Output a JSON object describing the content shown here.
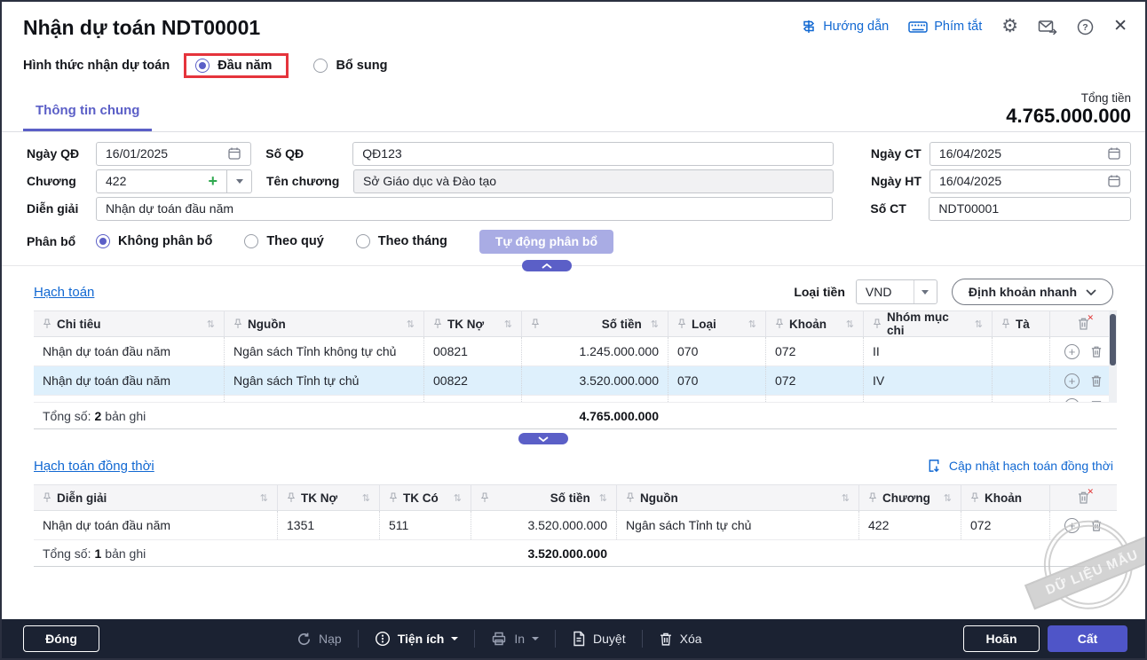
{
  "colors": {
    "accent": "#5b5fc7",
    "save_button": "#4f55c8",
    "highlight_box": "#e5343c",
    "link": "#1168d2",
    "selected_row": "#def0fc",
    "toolbar_bg": "#1b2232"
  },
  "window": {
    "title": "Nhận dự toán NDT00001"
  },
  "header": {
    "guide": "Hướng dẫn",
    "shortcut": "Phím tắt"
  },
  "form_type": {
    "label": "Hình thức nhận dự toán",
    "options": [
      {
        "label": "Đầu năm",
        "selected": true
      },
      {
        "label": "Bổ sung",
        "selected": false
      }
    ]
  },
  "tabs": [
    {
      "label": "Thông tin chung"
    }
  ],
  "total": {
    "label": "Tổng tiền",
    "value": "4.765.000.000"
  },
  "fields": {
    "ngay_qd": {
      "label": "Ngày QĐ",
      "value": "16/01/2025"
    },
    "so_qd": {
      "label": "Số QĐ",
      "value": "QĐ123"
    },
    "ngay_ct": {
      "label": "Ngày CT",
      "value": "16/04/2025"
    },
    "chuong": {
      "label": "Chương",
      "value": "422"
    },
    "ten_chuong": {
      "label": "Tên chương",
      "value": "Sở Giáo dục và Đào tạo"
    },
    "ngay_ht": {
      "label": "Ngày HT",
      "value": "16/04/2025"
    },
    "dien_giai": {
      "label": "Diễn giải",
      "value": "Nhận dự toán đầu năm"
    },
    "so_ct": {
      "label": "Số CT",
      "value": "NDT00001"
    },
    "phan_bo": {
      "label": "Phân bổ",
      "options": [
        {
          "label": "Không phân bổ",
          "selected": true
        },
        {
          "label": "Theo quý",
          "selected": false
        },
        {
          "label": "Theo tháng",
          "selected": false
        }
      ],
      "auto_button": "Tự động phân bổ"
    }
  },
  "hach_toan": {
    "title": "Hạch toán",
    "currency_label": "Loại tiền",
    "currency": "VND",
    "quick_button": "Định khoản nhanh",
    "columns": [
      "Chi tiêu",
      "Nguồn",
      "TK Nợ",
      "Số tiền",
      "Loại",
      "Khoản",
      "Nhóm mục chi",
      "Tà"
    ],
    "rows": [
      [
        "Nhận dự toán đầu năm",
        "Ngân sách Tỉnh không tự chủ",
        "00821",
        "1.245.000.000",
        "070",
        "072",
        "II"
      ],
      [
        "Nhận dự toán đầu năm",
        "Ngân sách Tỉnh tự chủ",
        "00822",
        "3.520.000.000",
        "070",
        "072",
        "IV"
      ]
    ],
    "footer": {
      "prefix": "Tổng số:",
      "count": "2",
      "suffix": "bản ghi",
      "total": "4.765.000.000"
    }
  },
  "hach_toan_dong_thoi": {
    "title": "Hạch toán đồng thời",
    "update_link": "Cập nhật hạch toán đồng thời",
    "columns": [
      "Diễn giải",
      "TK Nợ",
      "TK Có",
      "Số tiền",
      "Nguồn",
      "Chương",
      "Khoản"
    ],
    "rows": [
      [
        "Nhận dự toán đầu năm",
        "1351",
        "511",
        "3.520.000.000",
        "Ngân sách Tỉnh tự chủ",
        "422",
        "072"
      ]
    ],
    "footer": {
      "prefix": "Tổng số:",
      "count": "1",
      "suffix": "bản ghi",
      "total": "3.520.000.000"
    }
  },
  "watermark": {
    "text": "DỮ LIỆU MẪU"
  },
  "toolbar": {
    "close": "Đóng",
    "reload": "Nạp",
    "utilities": "Tiện ích",
    "print": "In",
    "approve": "Duyệt",
    "delete": "Xóa",
    "postpone": "Hoãn",
    "save": "Cất"
  }
}
